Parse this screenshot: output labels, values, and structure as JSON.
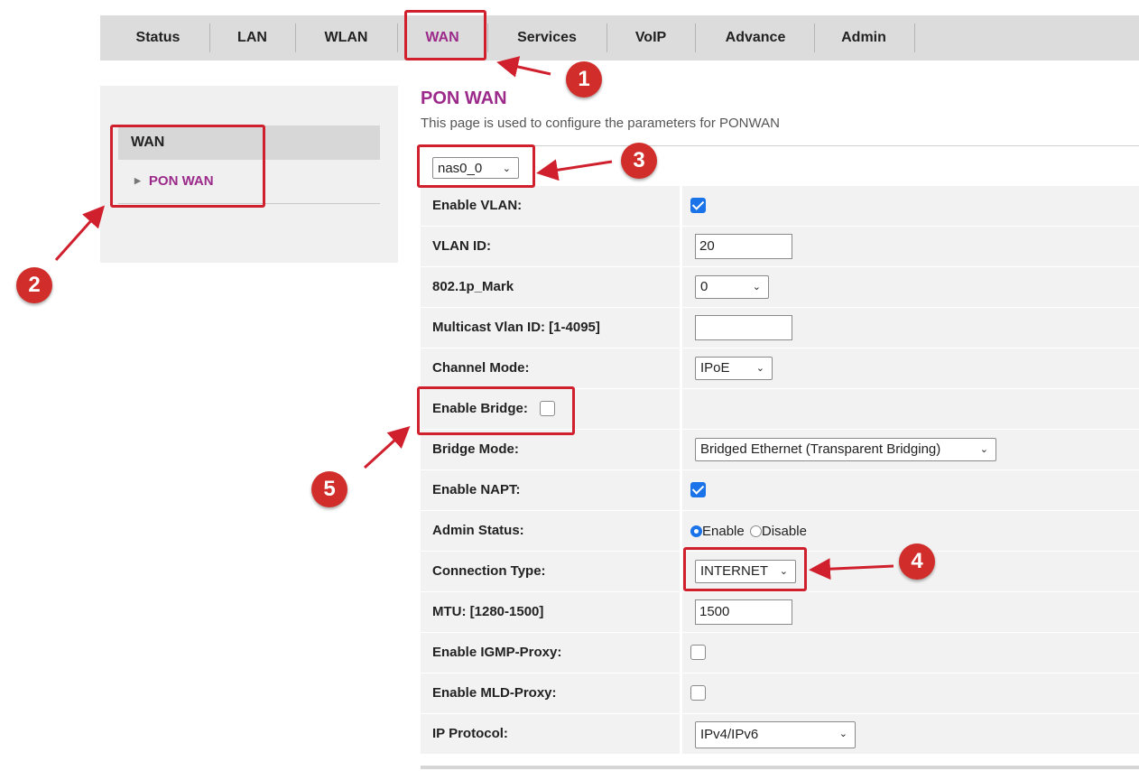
{
  "nav": {
    "tabs": [
      {
        "label": "Status"
      },
      {
        "label": "LAN"
      },
      {
        "label": "WLAN"
      },
      {
        "label": "WAN",
        "active": true
      },
      {
        "label": "Services"
      },
      {
        "label": "VoIP"
      },
      {
        "label": "Advance"
      },
      {
        "label": "Admin"
      }
    ]
  },
  "sidebar": {
    "heading": "WAN",
    "items": [
      {
        "label": "PON WAN"
      }
    ]
  },
  "main": {
    "title": "PON WAN",
    "description": "This page is used to configure the parameters for PONWAN",
    "interface_select": "nas0_0",
    "fields": {
      "enable_vlan": {
        "label": "Enable VLAN:",
        "checked": true
      },
      "vlan_id": {
        "label": "VLAN ID:",
        "value": "20"
      },
      "p8021_mark": {
        "label": "802.1p_Mark",
        "value": "0"
      },
      "multicast_vlan": {
        "label": "Multicast Vlan ID: [1-4095]",
        "value": ""
      },
      "channel_mode": {
        "label": "Channel Mode:",
        "value": "IPoE"
      },
      "enable_bridge": {
        "label": "Enable Bridge:",
        "checked": false
      },
      "bridge_mode": {
        "label": "Bridge Mode:",
        "value": "Bridged Ethernet (Transparent Bridging)"
      },
      "enable_napt": {
        "label": "Enable NAPT:",
        "checked": true
      },
      "admin_status": {
        "label": "Admin Status:",
        "enable_label": "Enable",
        "disable_label": "Disable",
        "value": "Enable"
      },
      "connection_type": {
        "label": "Connection Type:",
        "value": "INTERNET"
      },
      "mtu": {
        "label": "MTU: [1280-1500]",
        "value": "1500"
      },
      "igmp_proxy": {
        "label": "Enable IGMP-Proxy:",
        "checked": false
      },
      "mld_proxy": {
        "label": "Enable MLD-Proxy:",
        "checked": false
      },
      "ip_protocol": {
        "label": "IP Protocol:",
        "value": "IPv4/IPv6"
      }
    }
  },
  "annotations": {
    "badges": [
      "1",
      "2",
      "3",
      "4",
      "5"
    ],
    "color": "#d12d2a"
  },
  "colors": {
    "accent": "#9b2a8a",
    "checkbox": "#1a73e8",
    "annotation": "#d0202e"
  }
}
